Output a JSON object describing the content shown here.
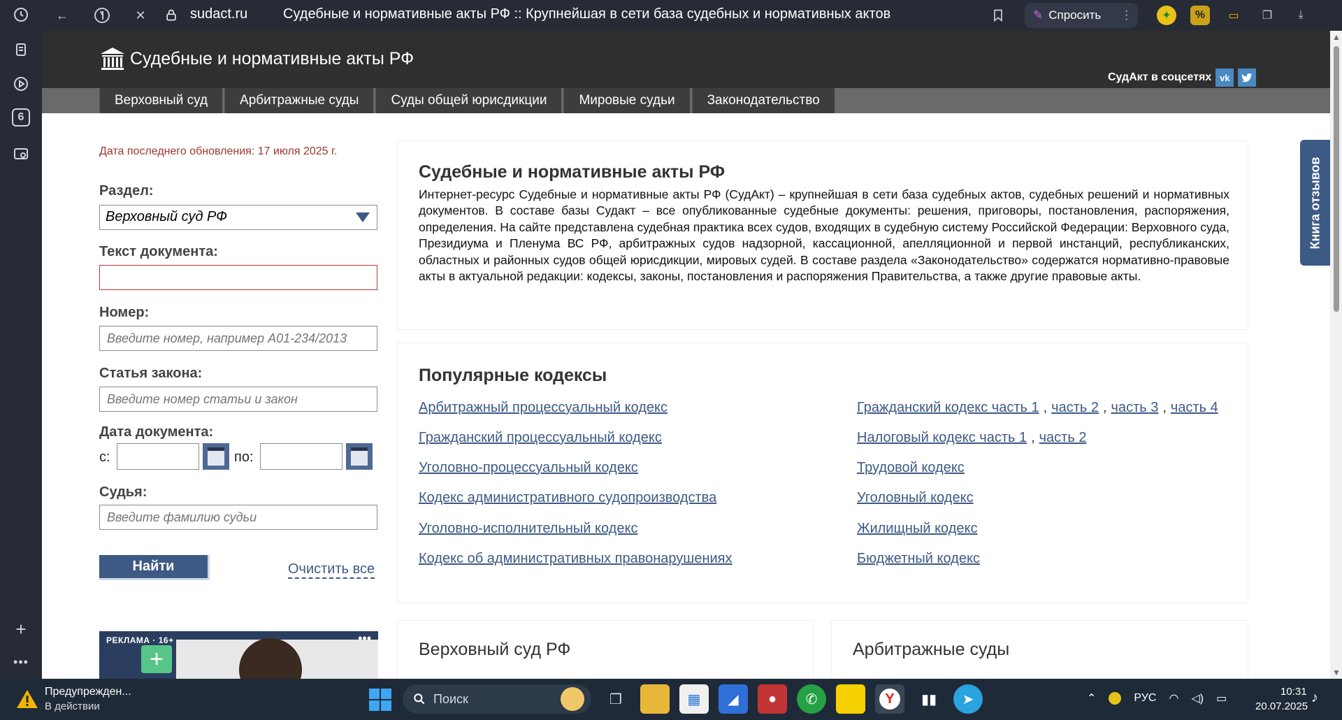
{
  "browser": {
    "domain": "sudact.ru",
    "tab_title": "Судебные и нормативные акты РФ :: Крупнейшая в сети база судебных и нормативных актов",
    "ask_label": "Спросить",
    "sidebar_badge": "6"
  },
  "site": {
    "logo_text": "Судебные и нормативные акты РФ",
    "social_label": "СудАкт в соцсетях",
    "social_vk": "vk",
    "nav": [
      {
        "label": "Верховный суд"
      },
      {
        "label": "Арбитражные суды"
      },
      {
        "label": "Суды общей юрисдикции"
      },
      {
        "label": "Мировые судьи"
      },
      {
        "label": "Законодательство"
      }
    ]
  },
  "search_form": {
    "update_date": "Дата последнего обновления: 17 июля 2025 г.",
    "section_label": "Раздел:",
    "section_value": "Верховный суд РФ",
    "text_label": "Текст документа:",
    "number_label": "Номер:",
    "number_placeholder": "Введите номер, например А01-234/2013",
    "article_label": "Статья закона:",
    "article_placeholder": "Введите номер статьи и закон",
    "date_label": "Дата документа:",
    "date_from": "с:",
    "date_to": "по:",
    "judge_label": "Судья:",
    "judge_placeholder": "Введите фамилию судьи",
    "search_button": "Найти",
    "clear_link": "Очистить все"
  },
  "ad": {
    "label": "РЕКЛАМА · 16+",
    "menu": "•••"
  },
  "about": {
    "heading": "Судебные и нормативные акты РФ",
    "text": "Интернет-ресурс Судебные и нормативные акты РФ (СудАкт) – крупнейшая в сети база судебных актов, судебных решений и нормативных документов. В составе базы Судакт – все опубликованные судебные документы: решения, приговоры, постановления, распоряжения, определения. На сайте представлена судебная практика всех судов, входящих в судебную систему Российской Федерации: Верховного суда, Президиума и Пленума ВС РФ, арбитражных судов надзорной, кассационной, апелляционной и первой инстанций, республиканских, областных и районных судов общей юрисдикции, мировых судей. В составе раздела «Законодательство» содержатся нормативно-правовые акты в актуальной редакции: кодексы, законы, постановления и распоряжения Правительства, а также другие правовые акты."
  },
  "codes": {
    "heading": "Популярные кодексы",
    "left": [
      "Арбитражный процессуальный кодекс",
      "Гражданский процессуальный кодекс",
      "Уголовно-процессуальный кодекс",
      "Кодекс административного судопроизводства",
      "Уголовно-исполнительный кодекс",
      "Кодекс об административных правонарушениях"
    ],
    "civil": {
      "main": "Гражданский кодекс часть 1",
      "sep": ",",
      "p2": "часть 2",
      "p3": "часть 3",
      "p4": "часть 4"
    },
    "tax": {
      "main": "Налоговый кодекс часть 1",
      "sep": ",",
      "p2": "часть 2"
    },
    "right": [
      "Трудовой кодекс",
      "Уголовный кодекс",
      "Жилищный кодекс",
      "Бюджетный кодекс"
    ]
  },
  "bottom_panels": {
    "supreme": "Верховный суд РФ",
    "arbitration": "Арбитражные суды"
  },
  "feedback_tab": "Книга отзывов",
  "taskbar": {
    "warning_title": "Предупрежден...",
    "warning_sub": "В действии",
    "search_label": "Поиск",
    "lang": "РУС",
    "time": "10:31",
    "date": "20.07.2025"
  },
  "colors": {
    "link": "#3d5a85",
    "header": "#2f2f2f",
    "update_date": "#a0372f",
    "button": "#3d5a85"
  }
}
